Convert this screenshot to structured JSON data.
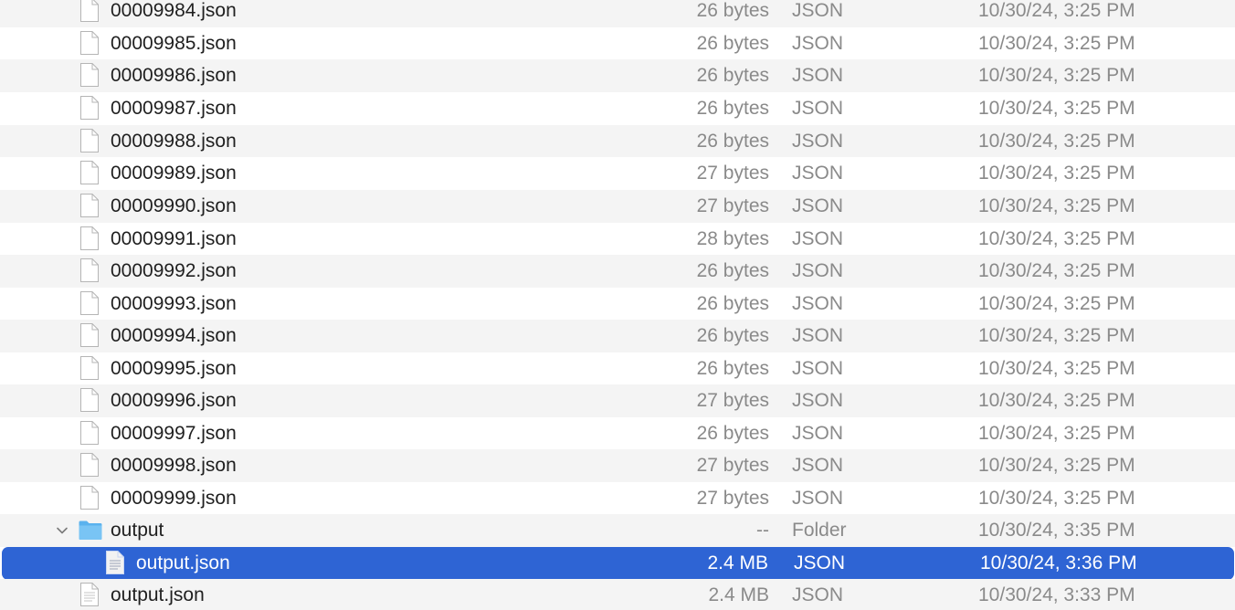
{
  "file_list": {
    "rows": [
      {
        "name": "00009984.json",
        "size": "26 bytes",
        "kind": "JSON",
        "date": "10/30/24, 3:25 PM",
        "icon": "document-icon"
      },
      {
        "name": "00009985.json",
        "size": "26 bytes",
        "kind": "JSON",
        "date": "10/30/24, 3:25 PM",
        "icon": "document-icon"
      },
      {
        "name": "00009986.json",
        "size": "26 bytes",
        "kind": "JSON",
        "date": "10/30/24, 3:25 PM",
        "icon": "document-icon"
      },
      {
        "name": "00009987.json",
        "size": "26 bytes",
        "kind": "JSON",
        "date": "10/30/24, 3:25 PM",
        "icon": "document-icon"
      },
      {
        "name": "00009988.json",
        "size": "26 bytes",
        "kind": "JSON",
        "date": "10/30/24, 3:25 PM",
        "icon": "document-icon"
      },
      {
        "name": "00009989.json",
        "size": "27 bytes",
        "kind": "JSON",
        "date": "10/30/24, 3:25 PM",
        "icon": "document-icon"
      },
      {
        "name": "00009990.json",
        "size": "27 bytes",
        "kind": "JSON",
        "date": "10/30/24, 3:25 PM",
        "icon": "document-icon"
      },
      {
        "name": "00009991.json",
        "size": "28 bytes",
        "kind": "JSON",
        "date": "10/30/24, 3:25 PM",
        "icon": "document-icon"
      },
      {
        "name": "00009992.json",
        "size": "26 bytes",
        "kind": "JSON",
        "date": "10/30/24, 3:25 PM",
        "icon": "document-icon"
      },
      {
        "name": "00009993.json",
        "size": "26 bytes",
        "kind": "JSON",
        "date": "10/30/24, 3:25 PM",
        "icon": "document-icon"
      },
      {
        "name": "00009994.json",
        "size": "26 bytes",
        "kind": "JSON",
        "date": "10/30/24, 3:25 PM",
        "icon": "document-icon"
      },
      {
        "name": "00009995.json",
        "size": "26 bytes",
        "kind": "JSON",
        "date": "10/30/24, 3:25 PM",
        "icon": "document-icon"
      },
      {
        "name": "00009996.json",
        "size": "27 bytes",
        "kind": "JSON",
        "date": "10/30/24, 3:25 PM",
        "icon": "document-icon"
      },
      {
        "name": "00009997.json",
        "size": "26 bytes",
        "kind": "JSON",
        "date": "10/30/24, 3:25 PM",
        "icon": "document-icon"
      },
      {
        "name": "00009998.json",
        "size": "27 bytes",
        "kind": "JSON",
        "date": "10/30/24, 3:25 PM",
        "icon": "document-icon"
      },
      {
        "name": "00009999.json",
        "size": "27 bytes",
        "kind": "JSON",
        "date": "10/30/24, 3:25 PM",
        "icon": "document-icon"
      },
      {
        "name": "output",
        "size": "--",
        "kind": "Folder",
        "date": "10/30/24, 3:35 PM",
        "icon": "folder-icon",
        "expanded": true
      },
      {
        "name": "output.json",
        "size": "2.4 MB",
        "kind": "JSON",
        "date": "10/30/24, 3:36 PM",
        "icon": "document-filled-icon",
        "selected": true
      },
      {
        "name": "output.json",
        "size": "2.4 MB",
        "kind": "JSON",
        "date": "10/30/24, 3:33 PM",
        "icon": "document-filled-icon"
      }
    ]
  },
  "colors": {
    "selection": "#2e64d4",
    "stripe": "#f4f4f4",
    "folder": "#5ab2ee",
    "secondary_text": "#8a8a8a"
  }
}
